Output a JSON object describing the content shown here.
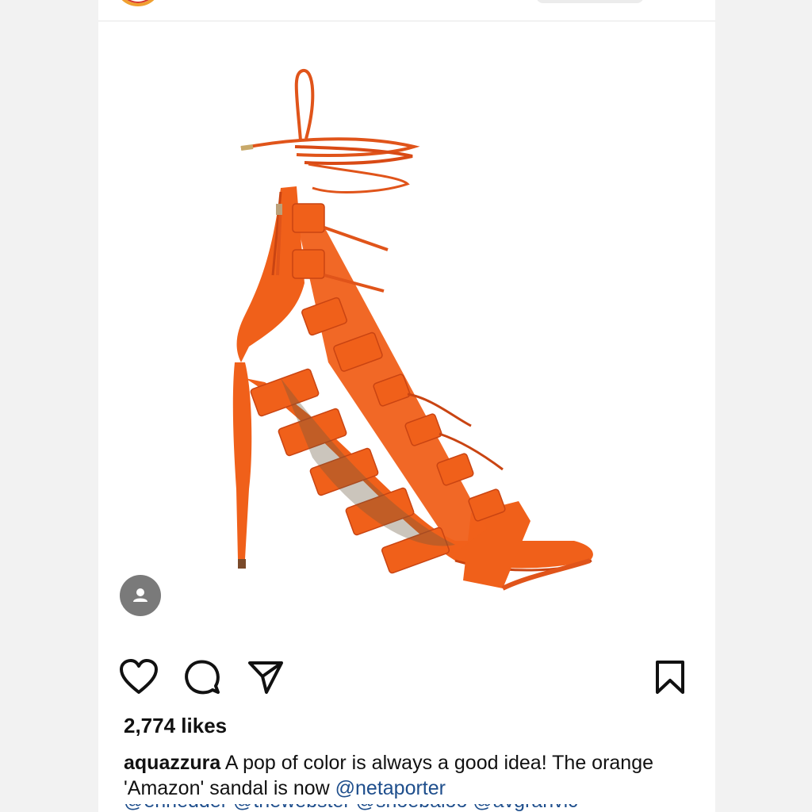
{
  "post": {
    "likes_text": "2,774 likes",
    "username": "aquazzura",
    "caption_part1": "A pop of color is always a good idea! The orange 'Amazon' sandal is now",
    "mention_1": "@netaporter",
    "cut_line_text": "@ennedder @thewebster @shoebaloo @avgranvic"
  },
  "colors": {
    "shoe_main": "#f0601a",
    "shoe_dark": "#c94412",
    "mention": "#1e4e8c",
    "tag_bg": "#7a7a7a"
  },
  "icons": {
    "like": "heart-icon",
    "comment": "comment-icon",
    "share": "paper-plane-icon",
    "save": "bookmark-icon",
    "tag": "person-icon"
  }
}
